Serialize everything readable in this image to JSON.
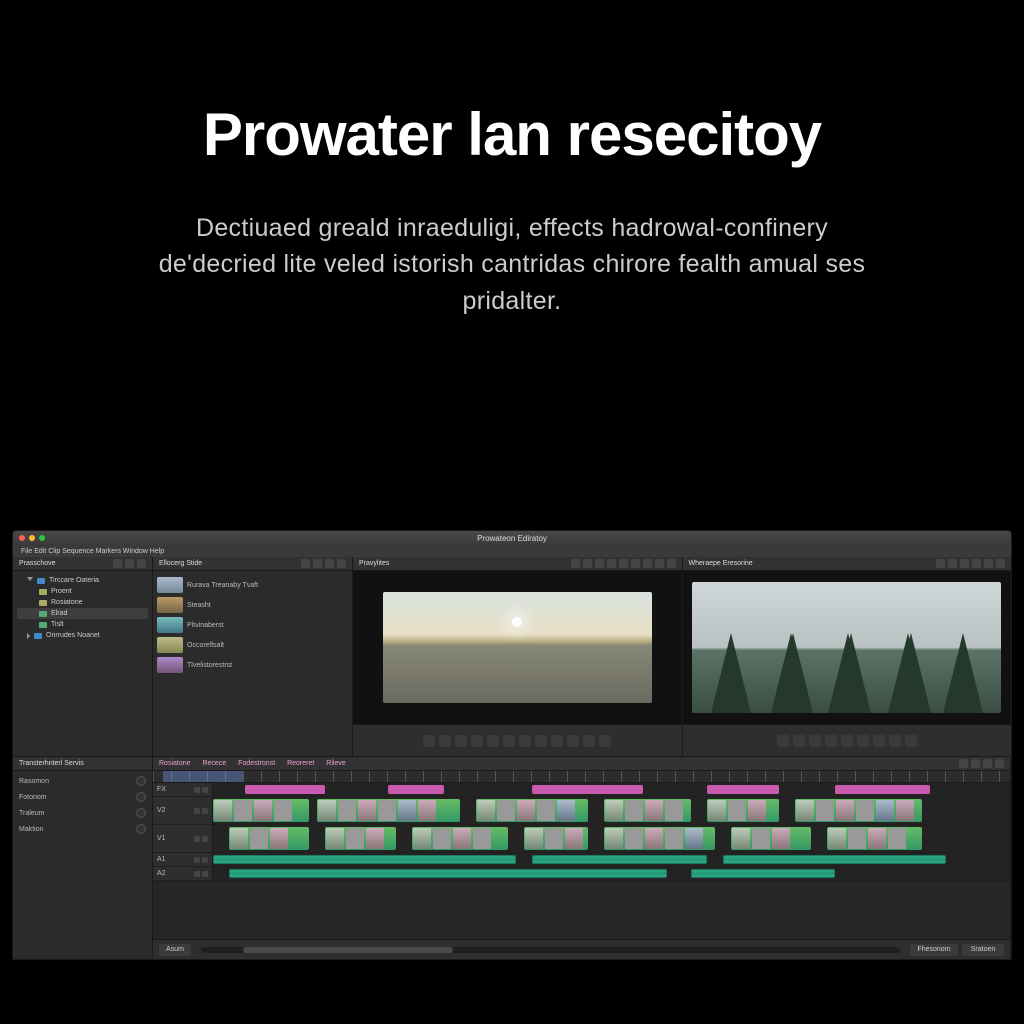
{
  "hero": {
    "title": "Prowater lan resecitoy",
    "subtitle": "Dectiuaed greald inraeduligi, effects hadrowal-confinery de'decried lite veled istorish cantridas chirore fealth amual ses pridalter."
  },
  "app": {
    "window_title": "Prowateon Ediratoy",
    "menubar": "File  Edit  Clip  Sequence  Markers  Window  Help"
  },
  "panels": {
    "project": {
      "title": "Prasschove",
      "items": [
        {
          "label": "Tirccare Oateria",
          "sel": false
        },
        {
          "label": "Proent",
          "sel": false
        },
        {
          "label": "Rosiatone",
          "sel": false
        },
        {
          "label": "Elrad",
          "sel": true
        },
        {
          "label": "Tislt",
          "sel": false
        },
        {
          "label": "Onrrudes Noanet",
          "sel": false
        }
      ]
    },
    "media": {
      "title": "Ellocerg Stide",
      "rows": [
        {
          "label": "Rurava Treanaby Tvaft"
        },
        {
          "label": "Steasht"
        },
        {
          "label": "Pltvinaberst"
        },
        {
          "label": "Occorelfsalt"
        },
        {
          "label": "Tlvelistorestrst"
        }
      ]
    },
    "source_monitor": {
      "title": "Pravylites"
    },
    "program_monitor": {
      "title": "Wheraepe Eresorine"
    },
    "aux": {
      "title": "Transterhnterl Servis",
      "rows": [
        "Rasomon",
        "Fotonom",
        "Traleum",
        "Maktion"
      ]
    }
  },
  "timeline": {
    "tabs": [
      "Rosiatone",
      "Recece",
      "Fodestronst",
      "Reoreret",
      "Rileve"
    ],
    "tracks": {
      "fx": "FX",
      "v2": "V2",
      "v1": "V1",
      "a1": "A1",
      "a2": "A2"
    },
    "footer": {
      "left_btn": "Asum",
      "right_a": "Fhesonom",
      "right_b": "Sratoen"
    }
  }
}
